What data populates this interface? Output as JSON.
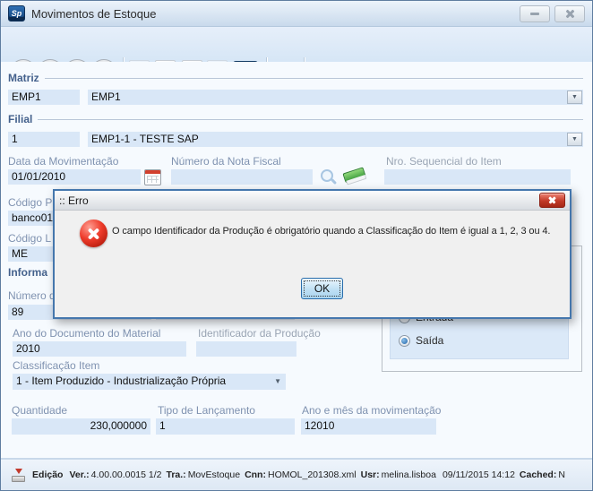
{
  "window": {
    "title": "Movimentos de Estoque",
    "logo_text": "Sp"
  },
  "toolbar": {
    "icons": [
      "first-record",
      "previous-record",
      "next-record",
      "last-record",
      "new-document",
      "edit",
      "undo",
      "cancel",
      "save",
      "lock"
    ]
  },
  "form": {
    "matriz": {
      "section_label": "Matriz",
      "code": "EMP1",
      "name": "EMP1"
    },
    "filial": {
      "section_label": "Filial",
      "code": "1",
      "name": "EMP1-1 - TESTE SAP"
    },
    "data_movimentacao": {
      "label": "Data da Movimentação",
      "value": "01/01/2010"
    },
    "nota_fiscal": {
      "label": "Número da Nota Fiscal",
      "value": ""
    },
    "sequencial_item": {
      "label": "Nro. Sequencial do Item",
      "value": ""
    },
    "codigo_p": {
      "label": "Código P",
      "value": "banco01"
    },
    "codigo_l": {
      "label": "Código L",
      "value": "ME"
    },
    "informacoes_header": "Informa",
    "numero_doc": {
      "label": "Número d",
      "value": "89",
      "extra_value": ""
    },
    "ano_documento": {
      "label": "Ano do Documento do Material",
      "value": "2010"
    },
    "identificador_producao": {
      "label": "Identificador da Produção",
      "value": ""
    },
    "movimento": {
      "radios": [
        {
          "label": "Entrada",
          "selected": false
        },
        {
          "label": "Saída",
          "selected": true
        }
      ]
    },
    "classificacao_item": {
      "label": "Classificação Item",
      "value": "1 - Item Produzido - Industrialização Própria"
    },
    "quantidade": {
      "label": "Quantidade",
      "value": "230,000000"
    },
    "tipo_lancamento": {
      "label": "Tipo de Lançamento",
      "value": "1"
    },
    "ano_mes": {
      "label": "Ano e mês da movimentação",
      "value": "12010"
    }
  },
  "dialog": {
    "title": ":: Erro",
    "message": "O campo Identificador da Produção é obrigatório quando a Classificação do Item é igual a 1, 2, 3 ou 4.",
    "ok_label": "OK"
  },
  "statusbar": {
    "items": [
      {
        "label": "Edição",
        "value": ""
      },
      {
        "label": "Ver.:",
        "value": "4.00.00.0015 1/2"
      },
      {
        "label": "Tra.:",
        "value": "MovEstoque"
      },
      {
        "label": "Cnn:",
        "value": "HOMOL_201308.xml"
      },
      {
        "label": "Usr:",
        "value": "melina.lisboa"
      },
      {
        "label": "",
        "value": "09/11/2015 14:12"
      },
      {
        "label": "Cached:",
        "value": "N"
      }
    ]
  }
}
